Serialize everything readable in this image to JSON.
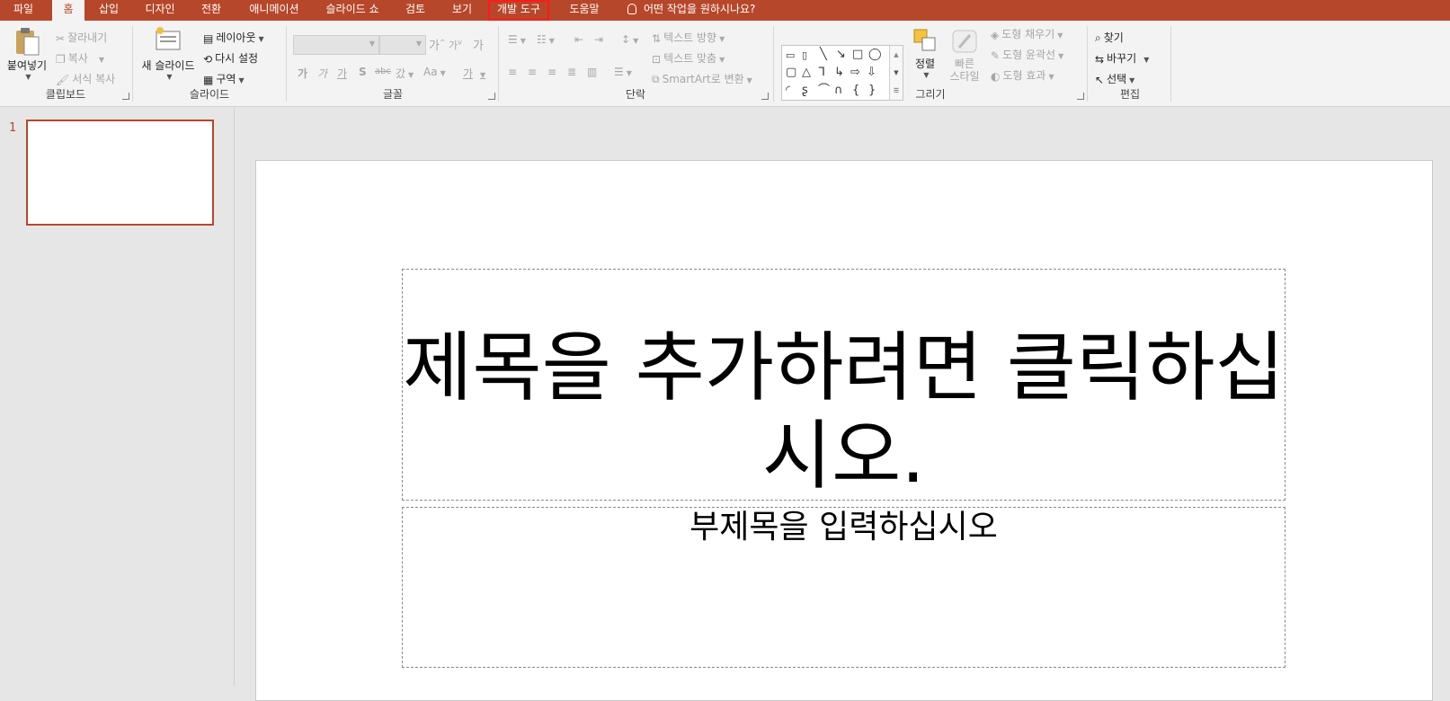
{
  "tabs": [
    {
      "label": "파일"
    },
    {
      "label": "홈"
    },
    {
      "label": "삽입"
    },
    {
      "label": "디자인"
    },
    {
      "label": "전환"
    },
    {
      "label": "애니메이션"
    },
    {
      "label": "슬라이드 쇼"
    },
    {
      "label": "검토"
    },
    {
      "label": "보기"
    },
    {
      "label": "개발 도구"
    },
    {
      "label": "도움말"
    }
  ],
  "tell_me": "어떤 작업을 원하시나요?",
  "colors": {
    "accent": "#b7472a",
    "highlight": "#ff1a1a"
  },
  "clipboard": {
    "label": "클립보드",
    "paste": "붙여넣기",
    "cut": "잘라내기",
    "copy": "복사",
    "format_painter": "서식 복사"
  },
  "slides_group": {
    "label": "슬라이드",
    "new_slide": "새 슬라이드",
    "layout": "레이아웃",
    "reset": "다시 설정",
    "section": "구역"
  },
  "font": {
    "label": "글꼴",
    "grow": "가",
    "shrink": "가",
    "clear": "가",
    "bold": "가",
    "italic": "가",
    "underline": "가",
    "shadow": "S",
    "strike": "abc",
    "spacing": "갔",
    "case": "Aa",
    "color": "가"
  },
  "paragraph": {
    "label": "단락",
    "text_direction": "텍스트 방향",
    "align_text": "텍스트 맞춤",
    "smartart": "SmartArt로 변환"
  },
  "drawing": {
    "label": "그리기",
    "arrange": "정렬",
    "quick_styles_1": "빠른",
    "quick_styles_2": "스타일",
    "fill": "도형 채우기",
    "outline": "도형 윤곽선",
    "effects": "도형 효과"
  },
  "editing": {
    "label": "편집",
    "find": "찾기",
    "replace": "바꾸기",
    "select": "선택"
  },
  "thumbnail": {
    "number": "1"
  },
  "slide": {
    "title": "제목을 추가하려면 클릭하십시오.",
    "subtitle": "부제목을 입력하십시오"
  }
}
